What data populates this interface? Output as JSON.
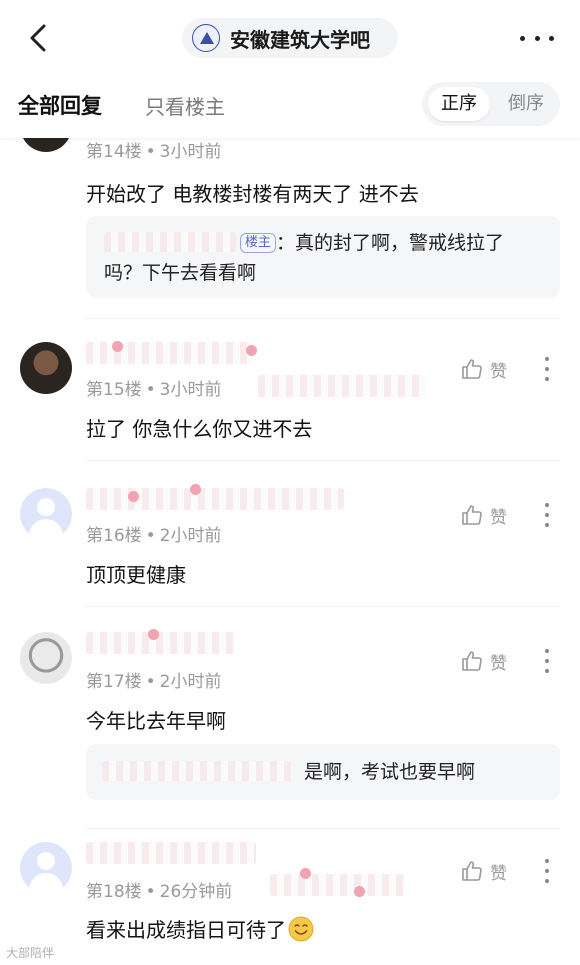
{
  "header": {
    "back_icon": "chevron-left-icon",
    "forum_title": "安徽建筑大学吧",
    "more_icon": "more-horizontal-icon"
  },
  "filter": {
    "all_replies": "全部回复",
    "op_only": "只看楼主",
    "order_asc": "正序",
    "order_desc": "倒序"
  },
  "posts": [
    {
      "floor": "第14楼",
      "time": "3小时前",
      "content": "开始改了 电教楼封楼有两天了 进不去",
      "subreply": {
        "badge": "楼主",
        "text_line1": "：真的封了啊，警戒线拉了",
        "text_line2": "吗？下午去看看啊"
      }
    },
    {
      "floor": "第15楼",
      "time": "3小时前",
      "like": "赞",
      "content": "拉了 你急什么你又进不去"
    },
    {
      "floor": "第16楼",
      "time": "2小时前",
      "like": "赞",
      "content": "顶顶更健康"
    },
    {
      "floor": "第17楼",
      "time": "2小时前",
      "like": "赞",
      "content": "今年比去年早啊",
      "subreply": {
        "text": "是啊，考试也要早啊"
      }
    },
    {
      "floor": "第18楼",
      "time": "26分钟前",
      "like": "赞",
      "content": "看来出成绩指日可待了",
      "emoji": "smile-emoji-icon"
    }
  ],
  "separator": "•",
  "watermark": "大部陪伴",
  "colors": {
    "accent": "#5868c9",
    "meta_gray": "#9a9a9a",
    "subreply_bg": "#f5f6f8"
  }
}
